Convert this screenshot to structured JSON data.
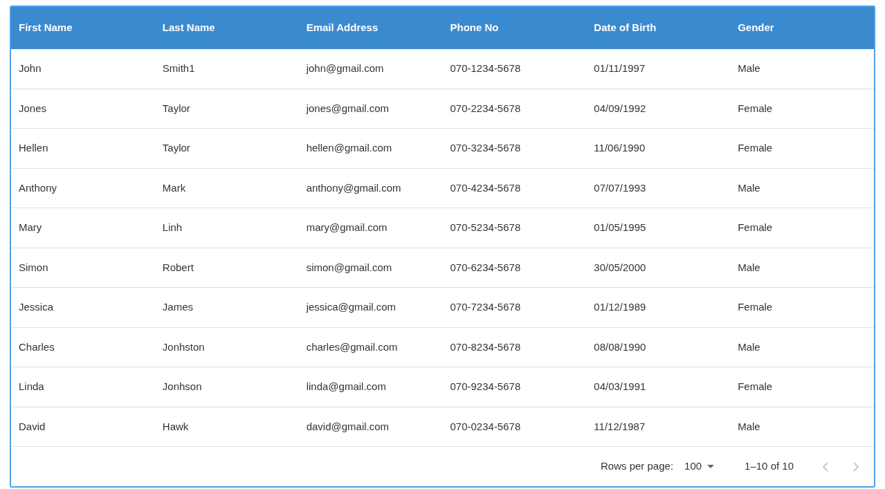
{
  "table": {
    "columns": [
      "First Name",
      "Last Name",
      "Email Address",
      "Phone No",
      "Date of Birth",
      "Gender"
    ],
    "rows": [
      [
        "John",
        "Smith1",
        "john@gmail.com",
        "070-1234-5678",
        "01/11/1997",
        "Male"
      ],
      [
        "Jones",
        "Taylor",
        "jones@gmail.com",
        "070-2234-5678",
        "04/09/1992",
        "Female"
      ],
      [
        "Hellen",
        "Taylor",
        "hellen@gmail.com",
        "070-3234-5678",
        "11/06/1990",
        "Female"
      ],
      [
        "Anthony",
        "Mark",
        "anthony@gmail.com",
        "070-4234-5678",
        "07/07/1993",
        "Male"
      ],
      [
        "Mary",
        "Linh",
        "mary@gmail.com",
        "070-5234-5678",
        "01/05/1995",
        "Female"
      ],
      [
        "Simon",
        "Robert",
        "simon@gmail.com",
        "070-6234-5678",
        "30/05/2000",
        "Male"
      ],
      [
        "Jessica",
        "James",
        "jessica@gmail.com",
        "070-7234-5678",
        "01/12/1989",
        "Female"
      ],
      [
        "Charles",
        "Jonhston",
        "charles@gmail.com",
        "070-8234-5678",
        "08/08/1990",
        "Male"
      ],
      [
        "Linda",
        "Jonhson",
        "linda@gmail.com",
        "070-9234-5678",
        "04/03/1991",
        "Female"
      ],
      [
        "David",
        "Hawk",
        "david@gmail.com",
        "070-0234-5678",
        "11/12/1987",
        "Male"
      ]
    ]
  },
  "pagination": {
    "rows_per_page_label": "Rows per page:",
    "rows_per_page": "100",
    "range": "1–10 of 10",
    "previous": {
      "disabled": true
    },
    "next": {
      "disabled": true
    }
  }
}
